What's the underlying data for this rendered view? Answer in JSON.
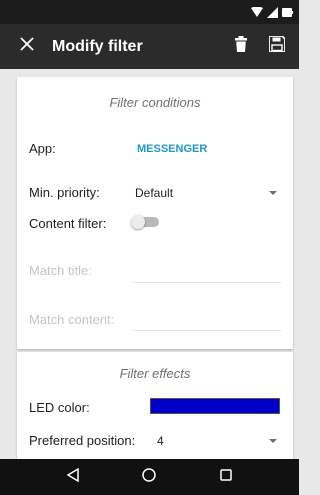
{
  "app_bar": {
    "title": "Modify filter",
    "close_icon": "close-icon",
    "delete_icon": "trash-icon",
    "save_icon": "save-icon"
  },
  "status_bar": {
    "icons": [
      "wifi-icon",
      "signal-icon",
      "battery-icon"
    ]
  },
  "conditions": {
    "title": "Filter conditions",
    "app_label": "App:",
    "app_value": "MESSENGER",
    "min_priority_label": "Min. priority:",
    "min_priority_value": "Default",
    "content_filter_label": "Content filter:",
    "content_filter_on": false,
    "match_title_label": "Match title:",
    "match_content_label": "Match content:"
  },
  "effects": {
    "title": "Filter effects",
    "led_color_label": "LED color:",
    "led_color": "#0000c8",
    "preferred_position_label": "Preferred position:",
    "preferred_position_value": "4"
  },
  "nav_bar": {
    "icons": [
      "back-icon",
      "home-icon",
      "recents-icon"
    ]
  },
  "colors": {
    "accent": "#2196c8",
    "app_bar": "#2b2b2b",
    "status_bar": "#1c1c1c"
  }
}
